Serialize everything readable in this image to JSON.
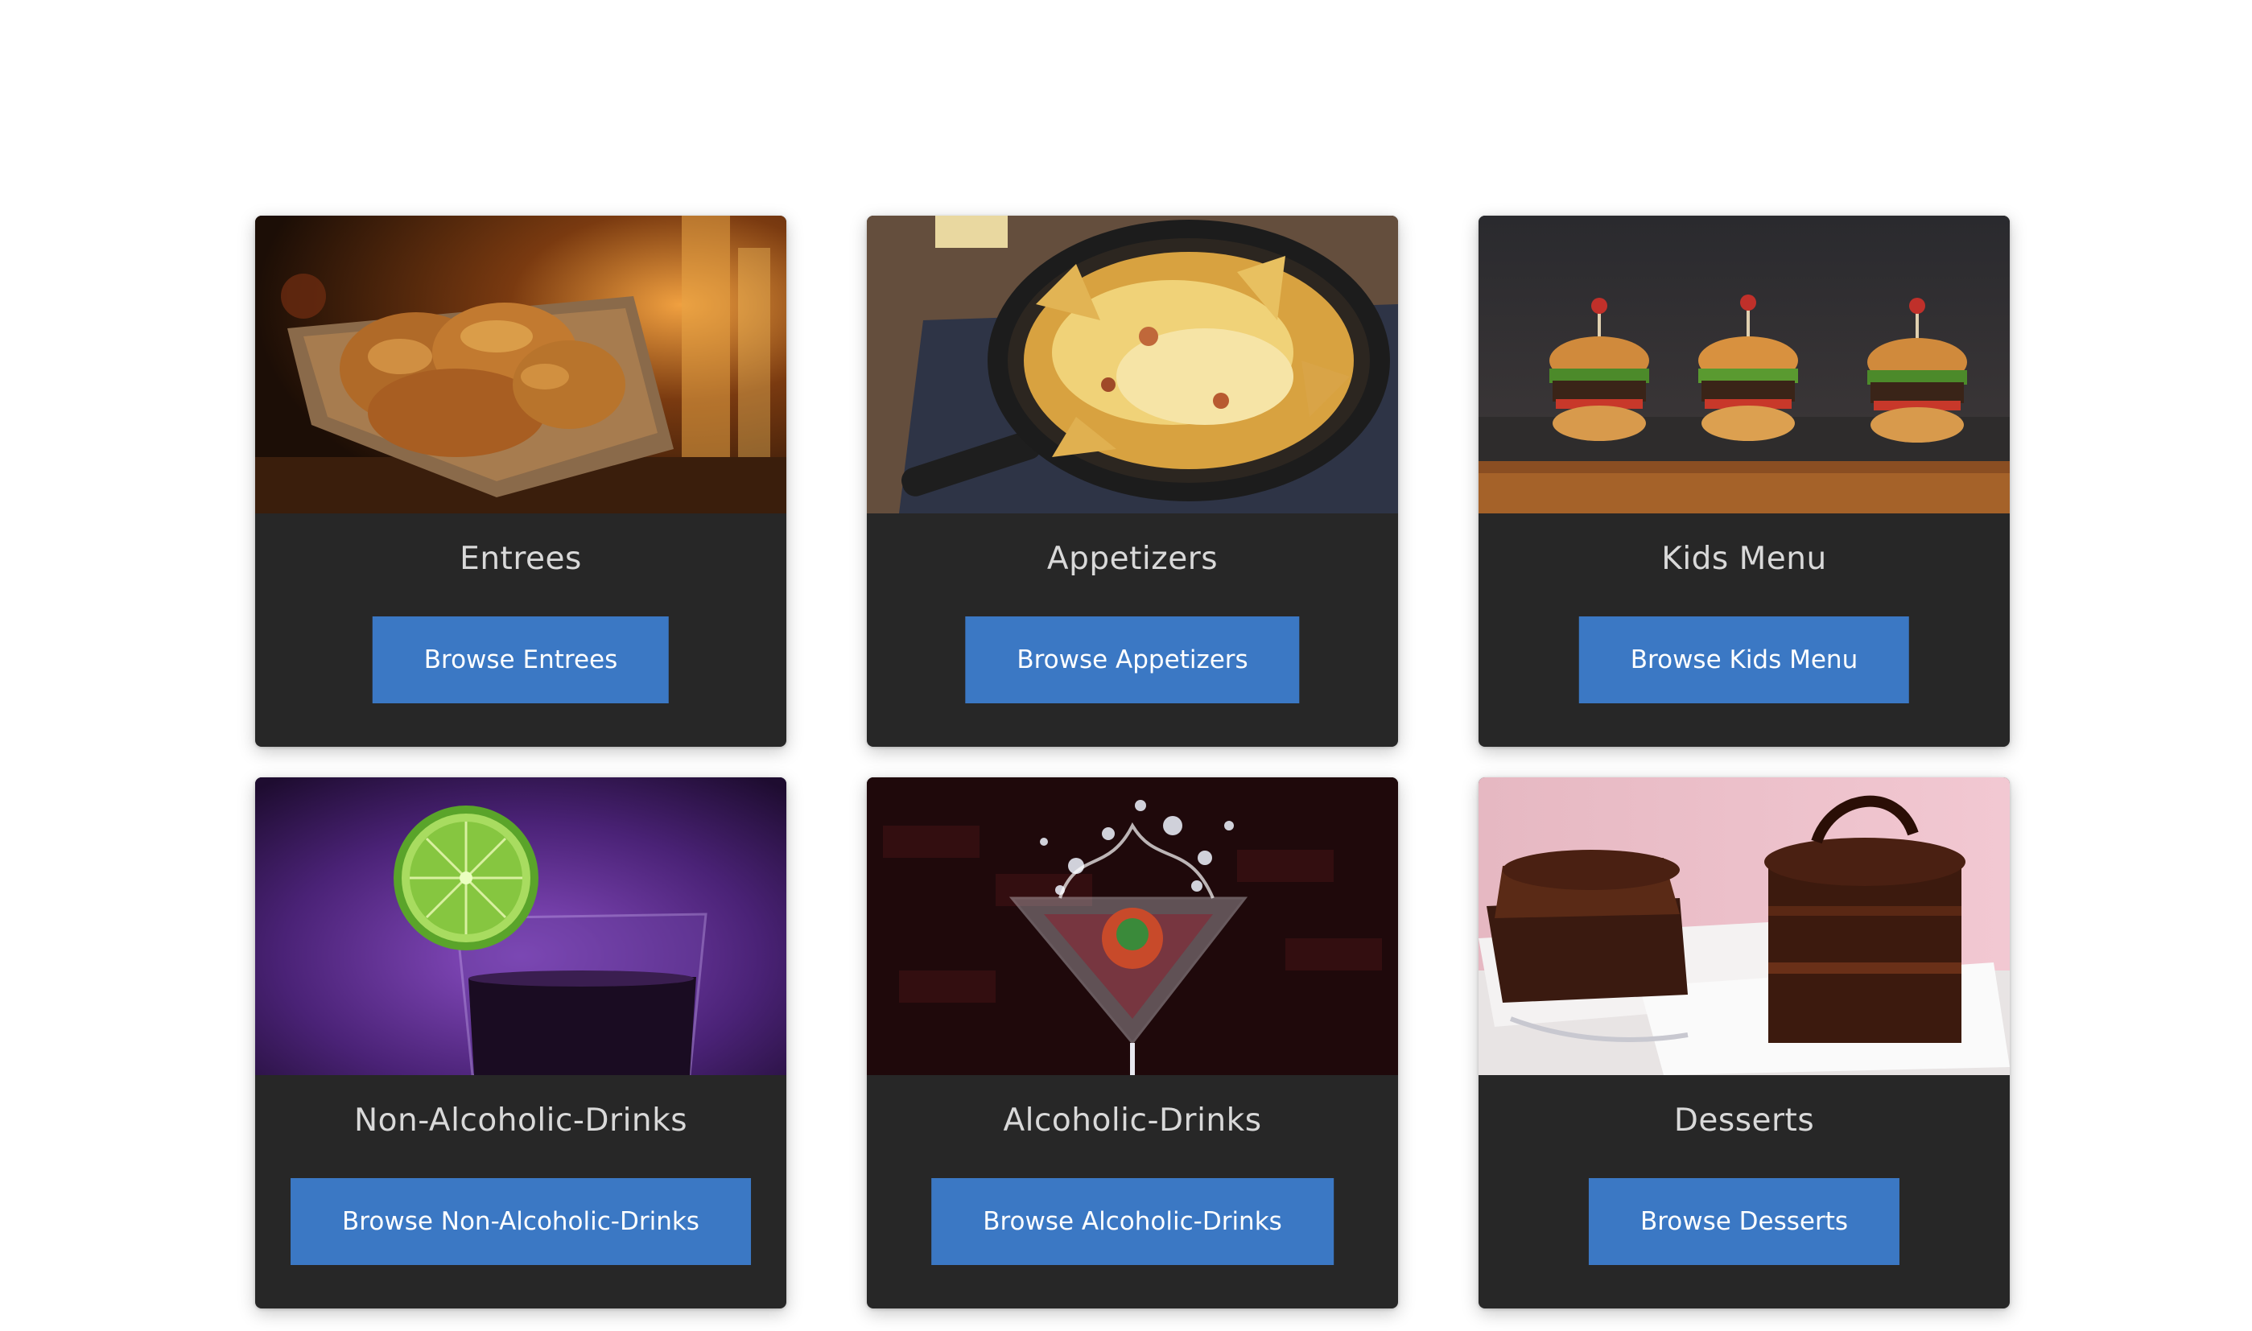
{
  "categories": [
    {
      "title": "Entrees",
      "button_label": "Browse Entrees",
      "photo": "fried-chicken-photo"
    },
    {
      "title": "Appetizers",
      "button_label": "Browse Appetizers",
      "photo": "nachos-skillet-photo"
    },
    {
      "title": "Kids Menu",
      "button_label": "Browse Kids Menu",
      "photo": "slider-burgers-photo"
    },
    {
      "title": "Non-Alcoholic-Drinks",
      "button_label": "Browse Non-Alcoholic-Drinks",
      "photo": "lime-drink-photo"
    },
    {
      "title": "Alcoholic-Drinks",
      "button_label": "Browse Alcoholic-Drinks",
      "photo": "martini-splash-photo"
    },
    {
      "title": "Desserts",
      "button_label": "Browse Desserts",
      "photo": "chocolate-cake-photo"
    }
  ],
  "colors": {
    "card_background": "#272727",
    "button_background": "#3b78c4",
    "title_text": "#d9d9d9",
    "button_text": "#ffffff"
  }
}
